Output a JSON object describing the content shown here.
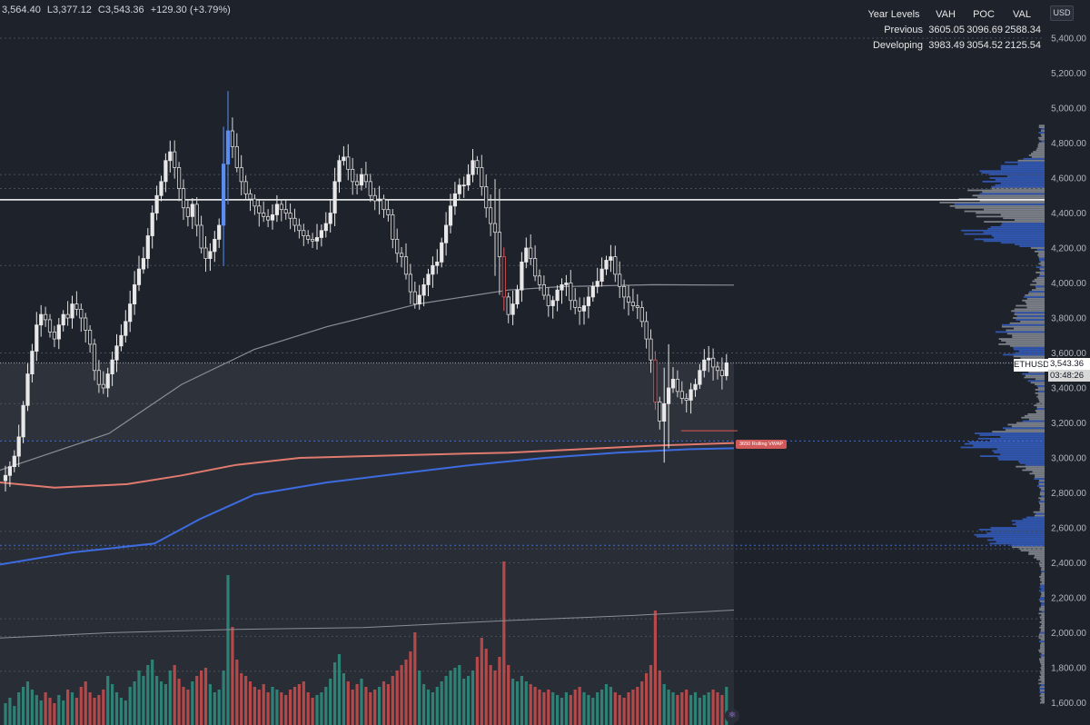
{
  "header": {
    "open": "3,564.40",
    "low": "L3,377.12",
    "close": "C3,543.36",
    "change": "+129.30 (+3.79%)"
  },
  "levels_table": {
    "headers": [
      "Year Levels",
      "VAH",
      "POC",
      "VAL"
    ],
    "rows": [
      {
        "label": "Previous",
        "vah": "3605.05",
        "poc": "3096.69",
        "val": "2588.34"
      },
      {
        "label": "Developing",
        "vah": "3983.49",
        "poc": "3054.52",
        "val": "2125.54"
      }
    ]
  },
  "price_axis": {
    "currency": "USD",
    "ticks": [
      "5,400.00",
      "5,200.00",
      "5,000.00",
      "4,800.00",
      "4,600.00",
      "4,400.00",
      "4,200.00",
      "4,000.00",
      "3,800.00",
      "3,600.00",
      "3,400.00",
      "3,200.00",
      "3,000.00",
      "2,800.00",
      "2,600.00",
      "2,400.00",
      "2,200.00",
      "2,000.00",
      "1,800.00",
      "1,600.00"
    ]
  },
  "price_tag": {
    "symbol": "ETHUSD",
    "price": "3,543.36",
    "countdown": "03:48:26"
  },
  "vwap_label": "3650 Rolling VWAP",
  "colors": {
    "background": "#1e222b",
    "up_candle": "#e8e8e8",
    "down_candle": "#d9d9d9",
    "up_highlight": "#5b8def",
    "down_highlight": "#e05555",
    "vwap_red": "#e07a6e",
    "vwap_blue": "#3d6be0",
    "volume_up": "#2e8c7c",
    "volume_down": "#c44d4d"
  },
  "chart_data": {
    "type": "candlestick",
    "symbol": "ETHUSD",
    "ylim": [
      1550,
      5500
    ],
    "yticks": [
      1600,
      1800,
      2000,
      2200,
      2400,
      2600,
      2800,
      3000,
      3200,
      3400,
      3600,
      3800,
      4000,
      4200,
      4400,
      4600,
      4800,
      5000,
      5200,
      5400
    ],
    "closes": [
      2900,
      2950,
      3010,
      3120,
      3300,
      3480,
      3610,
      3760,
      3820,
      3790,
      3720,
      3680,
      3760,
      3820,
      3800,
      3880,
      3850,
      3800,
      3730,
      3650,
      3500,
      3420,
      3400,
      3480,
      3560,
      3640,
      3700,
      3780,
      3880,
      3990,
      4080,
      4140,
      4270,
      4400,
      4500,
      4580,
      4700,
      4750,
      4660,
      4540,
      4430,
      4380,
      4450,
      4330,
      4200,
      4140,
      4180,
      4250,
      4330,
      4680,
      4870,
      4780,
      4660,
      4580,
      4510,
      4480,
      4440,
      4400,
      4380,
      4360,
      4390,
      4450,
      4420,
      4400,
      4370,
      4330,
      4300,
      4270,
      4250,
      4240,
      4260,
      4300,
      4340,
      4400,
      4580,
      4700,
      4720,
      4650,
      4580,
      4560,
      4620,
      4580,
      4500,
      4470,
      4480,
      4420,
      4390,
      4250,
      4170,
      4150,
      4050,
      3950,
      3880,
      3930,
      3990,
      4050,
      4100,
      4120,
      4230,
      4330,
      4440,
      4510,
      4560,
      4560,
      4620,
      4700,
      4660,
      4550,
      4430,
      4340,
      4290,
      4150,
      3920,
      3820,
      3880,
      3960,
      4120,
      4200,
      4140,
      4040,
      3990,
      3930,
      3870,
      3900,
      3960,
      3990,
      4000,
      3900,
      3860,
      3840,
      3870,
      3920,
      3980,
      4010,
      4080,
      4130,
      4150,
      4050,
      3980,
      3920,
      3890,
      3870,
      3860,
      3780,
      3680,
      3560,
      3320,
      3210,
      3310,
      3400,
      3450,
      3380,
      3340,
      3330,
      3390,
      3420,
      3500,
      3560,
      3570,
      3520,
      3500,
      3470,
      3543.36
    ],
    "volumes": [
      8,
      10,
      7,
      12,
      14,
      16,
      13,
      11,
      9,
      12,
      10,
      8,
      11,
      9,
      13,
      12,
      10,
      14,
      16,
      12,
      10,
      11,
      13,
      18,
      15,
      12,
      10,
      9,
      14,
      16,
      20,
      18,
      22,
      24,
      18,
      16,
      15,
      20,
      22,
      17,
      14,
      13,
      16,
      18,
      20,
      21,
      15,
      12,
      13,
      20,
      55,
      36,
      24,
      19,
      18,
      16,
      14,
      13,
      15,
      12,
      14,
      13,
      12,
      11,
      13,
      14,
      15,
      16,
      12,
      10,
      11,
      12,
      14,
      17,
      23,
      26,
      19,
      16,
      13,
      15,
      17,
      14,
      12,
      13,
      14,
      16,
      15,
      18,
      20,
      22,
      24,
      27,
      34,
      20,
      15,
      13,
      12,
      14,
      16,
      18,
      20,
      21,
      22,
      17,
      18,
      20,
      25,
      32,
      28,
      22,
      20,
      25,
      60,
      22,
      17,
      16,
      18,
      16,
      15,
      14,
      13,
      12,
      13,
      12,
      11,
      10,
      12,
      11,
      13,
      14,
      12,
      11,
      10,
      12,
      13,
      15,
      14,
      12,
      11,
      10,
      12,
      13,
      14,
      16,
      19,
      22,
      42,
      20,
      15,
      13,
      12,
      11,
      12,
      13,
      11,
      12,
      10,
      11,
      12,
      13,
      12,
      11,
      14
    ],
    "volume_ylim": [
      0,
      70
    ],
    "rolling_vwap": [
      {
        "name": "3650 Rolling VWAP",
        "color": "#e07a6e"
      },
      {
        "color": "#3d6be0"
      }
    ],
    "horizontal_levels": [
      4476,
      3605.05,
      3543.36,
      3096.69,
      2588.34,
      2500
    ],
    "annotations": [
      "3650 Rolling VWAP"
    ],
    "grid": false
  }
}
